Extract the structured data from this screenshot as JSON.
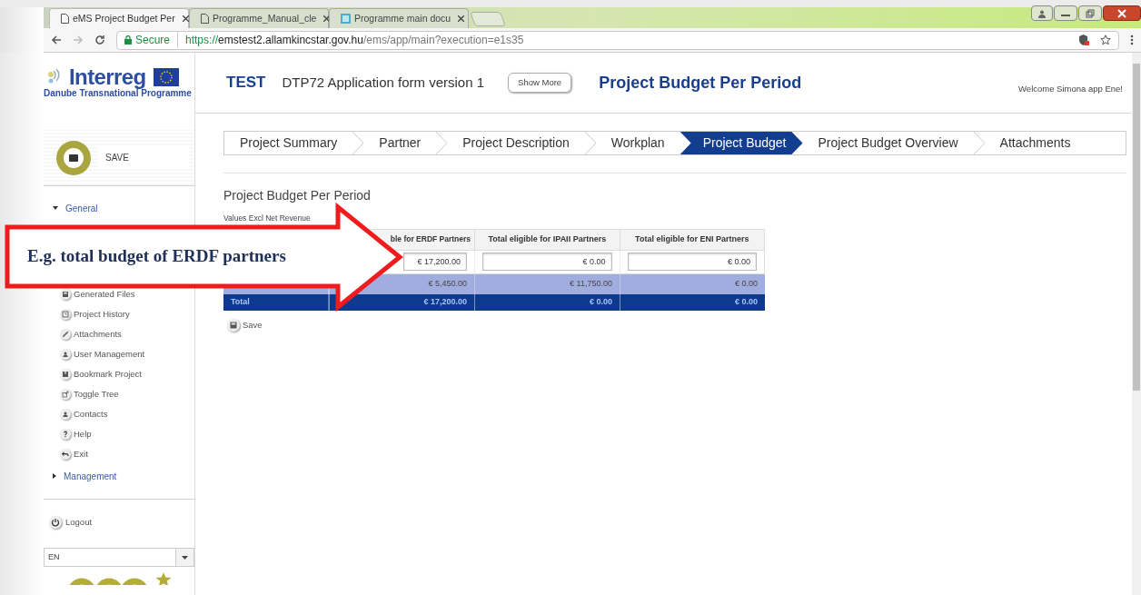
{
  "browser": {
    "tabs": [
      {
        "title": "eMS Project Budget Per",
        "selected": true
      },
      {
        "title": "Programme_Manual_cle",
        "selected": false
      },
      {
        "title": "Programme main docu",
        "selected": false
      }
    ],
    "address": {
      "secure_label": "Secure",
      "scheme": "https://",
      "host": "emstest2.allamkincstar.gov.hu",
      "path": "/ems/app/main?execution=e1s35"
    }
  },
  "sidebar": {
    "logo_word": "Interreg",
    "programme_name": "Danube Transnational Programme",
    "save_label": "SAVE",
    "groups": [
      {
        "label": "General",
        "expanded": true,
        "items": [
          "Generated Files",
          "Project History",
          "Attachments",
          "User Management",
          "Bookmark Project",
          "Toggle Tree",
          "Contacts",
          "Help",
          "Exit"
        ]
      },
      {
        "label": "Management",
        "expanded": false
      }
    ],
    "logout": "Logout",
    "language": "EN"
  },
  "header": {
    "mode": "TEST",
    "project": "DTP72 Application form version 1",
    "show_more": "Show More",
    "page_title": "Project Budget Per Period",
    "welcome": "Welcome Simona app Ene!"
  },
  "steps": [
    {
      "label": "Project Summary",
      "selected": false
    },
    {
      "label": "Partner",
      "selected": false
    },
    {
      "label": "Project Description",
      "selected": false
    },
    {
      "label": "Workplan",
      "selected": false
    },
    {
      "label": "Project Budget",
      "selected": true
    },
    {
      "label": "Project Budget Overview",
      "selected": false
    },
    {
      "label": "Attachments",
      "selected": false
    }
  ],
  "content": {
    "title": "Project Budget Per Period",
    "subtitle": "Values Excl Net Revenue",
    "table": {
      "columns": [
        "ble for ERDF Partners",
        "Total eligible for IPAII Partners",
        "Total eligible for ENI Partners"
      ],
      "rows": [
        {
          "kind": "input",
          "values": [
            "€ 17,200.00",
            "€ 0.00",
            "€ 0.00"
          ]
        },
        {
          "kind": "partner",
          "values": [
            "€ 5,450.00",
            "€ 11,750.00",
            "€ 0.00"
          ]
        },
        {
          "kind": "total",
          "label": "Total",
          "values": [
            "€ 17,200.00",
            "€ 0.00",
            "€ 0.00"
          ]
        }
      ]
    },
    "save": "Save"
  },
  "callout": {
    "text": "E.g. total budget of ERDF partners"
  }
}
